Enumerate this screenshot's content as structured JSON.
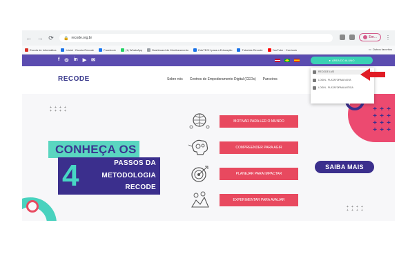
{
  "browser": {
    "nav": {
      "back": "←",
      "forward": "→",
      "reload": "⟳"
    },
    "url": "recode.org.br",
    "profile_label": "Em...",
    "menu_glyph": "⋮",
    "bookmarks": [
      {
        "label": "Escola de Informática",
        "color": "#d93025"
      },
      {
        "label": "Inicial · Escola Recode",
        "color": "#1a73e8"
      },
      {
        "label": "Facebook",
        "color": "#1877f2"
      },
      {
        "label": "(1) WhatsApp",
        "color": "#25d366"
      },
      {
        "label": "Dashboard de Monitoramento",
        "color": "#9aa0a6"
      },
      {
        "label": "EduTECH para a Educação",
        "color": "#1a73e8"
      },
      {
        "label": "Tutoriais Recode",
        "color": "#1a73e8"
      },
      {
        "label": "YouTube · Currículo",
        "color": "#ff0000"
      }
    ],
    "bookmarks_other": "Outros favoritos"
  },
  "site": {
    "social_icons": [
      "f",
      "◎",
      "in",
      "▶",
      "✉"
    ],
    "login_label": "ÁREA DO ALUNO",
    "logo": "RECODE",
    "nav_items": [
      "Sobre nós",
      "Centros de Empoderamento Digital (CEDs)",
      "Parceiros"
    ],
    "dropdown": [
      {
        "label": "RECODE LMS",
        "active": true
      },
      {
        "label": "LOGIN - PLATAFORMA NOVA"
      },
      {
        "label": "LOGIN - PLATAFORMA ANTIGA"
      }
    ],
    "hero": {
      "conheca": "CONHEÇA OS",
      "number": "4",
      "passos_line1": "PASSOS DA",
      "passos_line2": "METODOLOGIA",
      "passos_line3": "RECODE",
      "steps": [
        "MOTIVAR PARA LER O MUNDO",
        "COMPREENDER PARA AGIR",
        "PLANEJAR PARA IMPACTAR",
        "EXPERIMENTAR PARA AVALIAR"
      ],
      "saiba_mais": "SAIBA MAIS"
    }
  },
  "colors": {
    "purple": "#3b2f8d",
    "topbar": "#5b4cb0",
    "teal": "#49d2be",
    "pink": "#e8495f"
  }
}
